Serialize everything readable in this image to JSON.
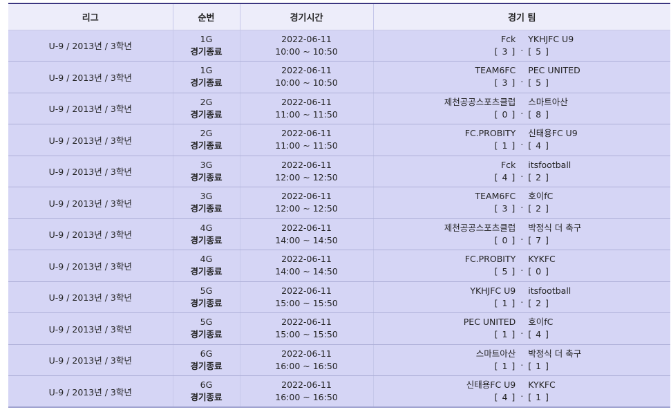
{
  "headers": {
    "league": "리그",
    "round": "순번",
    "time": "경기시간",
    "teams": "경기 팀"
  },
  "status_text": "경기종료",
  "separator": ".",
  "rows": [
    {
      "league": "U-9 / 2013년 / 3학년",
      "round": "1G",
      "date": "2022-06-11",
      "time": "10:00 ~ 10:50",
      "home": "Fck",
      "away": "YKHJFC U9",
      "home_score": "[ 3 ]",
      "away_score": "[ 5 ]"
    },
    {
      "league": "U-9 / 2013년 / 3학년",
      "round": "1G",
      "date": "2022-06-11",
      "time": "10:00 ~ 10:50",
      "home": "TEAM6FC",
      "away": "PEC UNITED",
      "home_score": "[ 3 ]",
      "away_score": "[ 5 ]"
    },
    {
      "league": "U-9 / 2013년 / 3학년",
      "round": "2G",
      "date": "2022-06-11",
      "time": "11:00 ~ 11:50",
      "home": "제천공공스포츠클럽",
      "away": "스마트아산",
      "home_score": "[ 0 ]",
      "away_score": "[ 8 ]"
    },
    {
      "league": "U-9 / 2013년 / 3학년",
      "round": "2G",
      "date": "2022-06-11",
      "time": "11:00 ~ 11:50",
      "home": "FC.PROBITY",
      "away": "신태용FC U9",
      "home_score": "[ 1 ]",
      "away_score": "[ 4 ]"
    },
    {
      "league": "U-9 / 2013년 / 3학년",
      "round": "3G",
      "date": "2022-06-11",
      "time": "12:00 ~ 12:50",
      "home": "Fck",
      "away": "itsfootball",
      "home_score": "[ 4 ]",
      "away_score": "[ 2 ]"
    },
    {
      "league": "U-9 / 2013년 / 3학년",
      "round": "3G",
      "date": "2022-06-11",
      "time": "12:00 ~ 12:50",
      "home": "TEAM6FC",
      "away": "호이fC",
      "home_score": "[ 3 ]",
      "away_score": "[ 2 ]"
    },
    {
      "league": "U-9 / 2013년 / 3학년",
      "round": "4G",
      "date": "2022-06-11",
      "time": "14:00 ~ 14:50",
      "home": "제천공공스포츠클럽",
      "away": "박정식 더 축구",
      "home_score": "[ 0 ]",
      "away_score": "[ 7 ]"
    },
    {
      "league": "U-9 / 2013년 / 3학년",
      "round": "4G",
      "date": "2022-06-11",
      "time": "14:00 ~ 14:50",
      "home": "FC.PROBITY",
      "away": "KYKFC",
      "home_score": "[ 5 ]",
      "away_score": "[ 0 ]"
    },
    {
      "league": "U-9 / 2013년 / 3학년",
      "round": "5G",
      "date": "2022-06-11",
      "time": "15:00 ~ 15:50",
      "home": "YKHJFC U9",
      "away": "itsfootball",
      "home_score": "[ 1 ]",
      "away_score": "[ 2 ]"
    },
    {
      "league": "U-9 / 2013년 / 3학년",
      "round": "5G",
      "date": "2022-06-11",
      "time": "15:00 ~ 15:50",
      "home": "PEC UNITED",
      "away": "호이fC",
      "home_score": "[ 1 ]",
      "away_score": "[ 4 ]"
    },
    {
      "league": "U-9 / 2013년 / 3학년",
      "round": "6G",
      "date": "2022-06-11",
      "time": "16:00 ~ 16:50",
      "home": "스마트아산",
      "away": "박정식 더 축구",
      "home_score": "[ 1 ]",
      "away_score": "[ 1 ]"
    },
    {
      "league": "U-9 / 2013년 / 3학년",
      "round": "6G",
      "date": "2022-06-11",
      "time": "16:00 ~ 16:50",
      "home": "신태용FC U9",
      "away": "KYKFC",
      "home_score": "[ 4 ]",
      "away_score": "[ 1 ]"
    }
  ]
}
